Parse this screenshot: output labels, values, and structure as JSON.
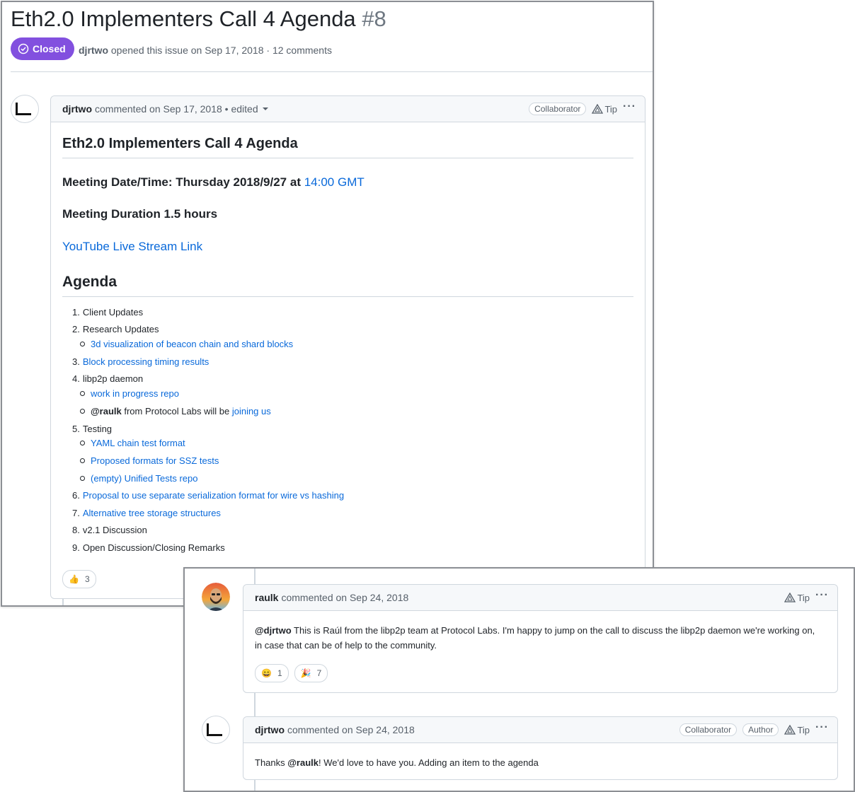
{
  "issue": {
    "title": "Eth2.0 Implementers Call 4 Agenda",
    "number": "#8",
    "state": "Closed",
    "author": "djrtwo",
    "meta_text": "opened this issue on Sep 17, 2018 · 12 comments"
  },
  "first_comment": {
    "author": "djrtwo",
    "meta": "commented on Sep 17, 2018 • edited",
    "badge": "Collaborator",
    "tip": "Tip",
    "more": "···",
    "heading": "Eth2.0 Implementers Call 4 Agenda",
    "date_label": "Meeting Date/Time: Thursday 2018/9/27 at ",
    "date_link": "14:00 GMT",
    "duration": "Meeting Duration 1.5 hours",
    "stream_link": "YouTube Live Stream Link",
    "agenda_heading": "Agenda",
    "agenda": [
      {
        "n": "1.",
        "text": "Client Updates",
        "link": false
      },
      {
        "n": "2.",
        "text": "Research Updates",
        "link": false
      },
      {
        "n": "",
        "sub": true,
        "text": "3d visualization of beacon chain and shard blocks",
        "link": true
      },
      {
        "n": "3.",
        "text": "Block processing timing results",
        "link": true
      },
      {
        "n": "4.",
        "text": "libp2p daemon",
        "link": false
      },
      {
        "n": "",
        "sub": true,
        "text": "work in progress repo",
        "link": true
      },
      {
        "n": "",
        "sub": true,
        "mention": "@raulk",
        "text": " from Protocol Labs will be ",
        "link_tail": "joining us"
      },
      {
        "n": "5.",
        "text": "Testing",
        "link": false
      },
      {
        "n": "",
        "sub": true,
        "text": "YAML chain test format",
        "link": true
      },
      {
        "n": "",
        "sub": true,
        "text": "Proposed formats for SSZ tests",
        "link": true
      },
      {
        "n": "",
        "sub": true,
        "text": "(empty) Unified Tests repo",
        "link": true
      },
      {
        "n": "6.",
        "text": "Proposal to use separate serialization format for wire vs hashing",
        "link": true
      },
      {
        "n": "7.",
        "text": "Alternative tree storage structures",
        "link": true
      },
      {
        "n": "8.",
        "text": "v2.1 Discussion",
        "link": false
      },
      {
        "n": "9.",
        "text": "Open Discussion/Closing Remarks",
        "link": false
      }
    ],
    "reaction_emoji": "👍",
    "reaction_count": "3"
  },
  "raulk_comment": {
    "author": "raulk",
    "meta": "commented on Sep 24, 2018",
    "tip": "Tip",
    "more": "···",
    "mention": "@djrtwo",
    "text": " This is Raúl from the libp2p team at Protocol Labs. I'm happy to jump on the call to discuss the libp2p daemon we're working on, in case that can be of help to the community.",
    "reactions": [
      {
        "emoji": "😄",
        "count": "1"
      },
      {
        "emoji": "🎉",
        "count": "7"
      }
    ]
  },
  "reply_comment": {
    "author": "djrtwo",
    "meta": "commented on Sep 24, 2018",
    "badge1": "Collaborator",
    "badge2": "Author",
    "tip": "Tip",
    "more": "···",
    "text_a": "Thanks ",
    "mention": "@raulk",
    "text_b": "! We'd love to have you. Adding an item to the agenda"
  },
  "colors": {
    "closed_badge": "#8250df",
    "link": "#0969da",
    "border": "#d0d7de",
    "header_bg": "#f6f8fa"
  }
}
